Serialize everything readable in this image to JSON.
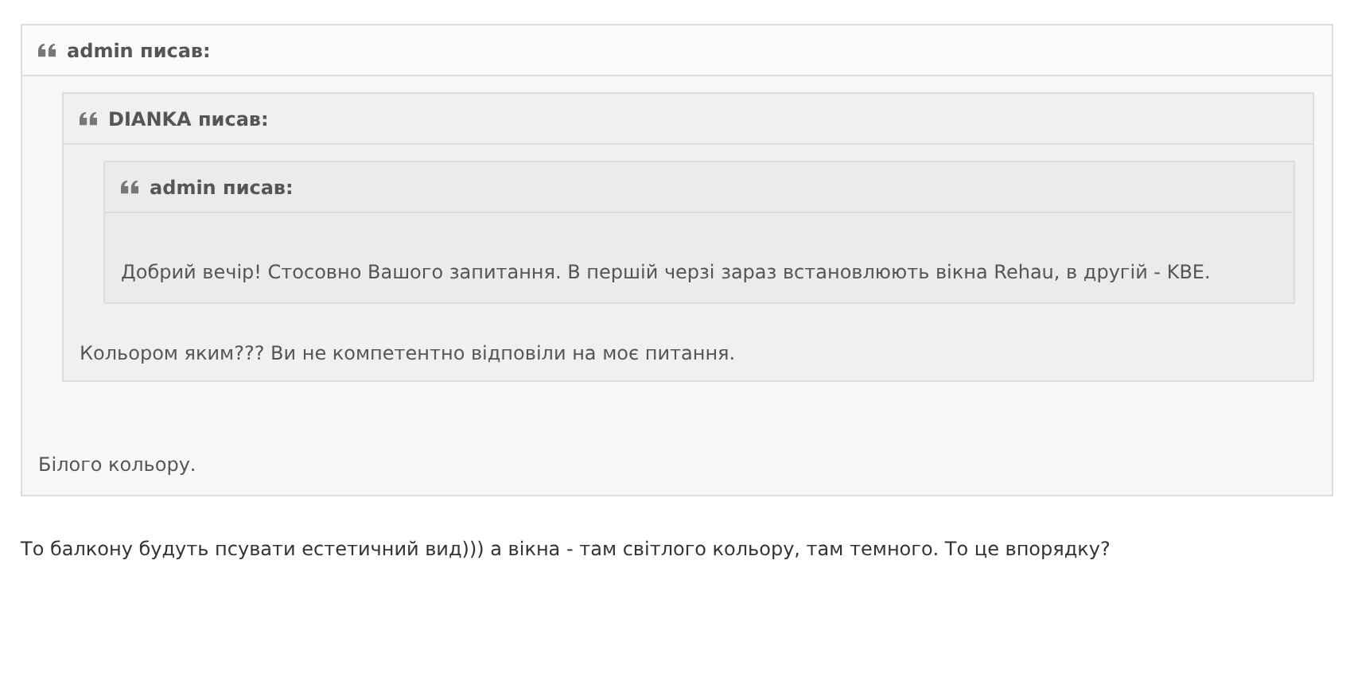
{
  "quote": {
    "author": "admin писав:",
    "quote": {
      "author": "DIANKA писав:",
      "quote": {
        "author": "admin писав:",
        "text": "Добрий вечір! Стосовно Вашого запитання. В першій черзі зараз встановлюють вікна Rehau, в другій - KBE."
      },
      "text": "Кольором яким??? Ви не компетентно відповіли на моє питання."
    },
    "text": "Білого кольору."
  },
  "message": "То балкону будуть псувати естетичний вид))) а вікна - там світлого кольору, там темного. То це впорядку?"
}
